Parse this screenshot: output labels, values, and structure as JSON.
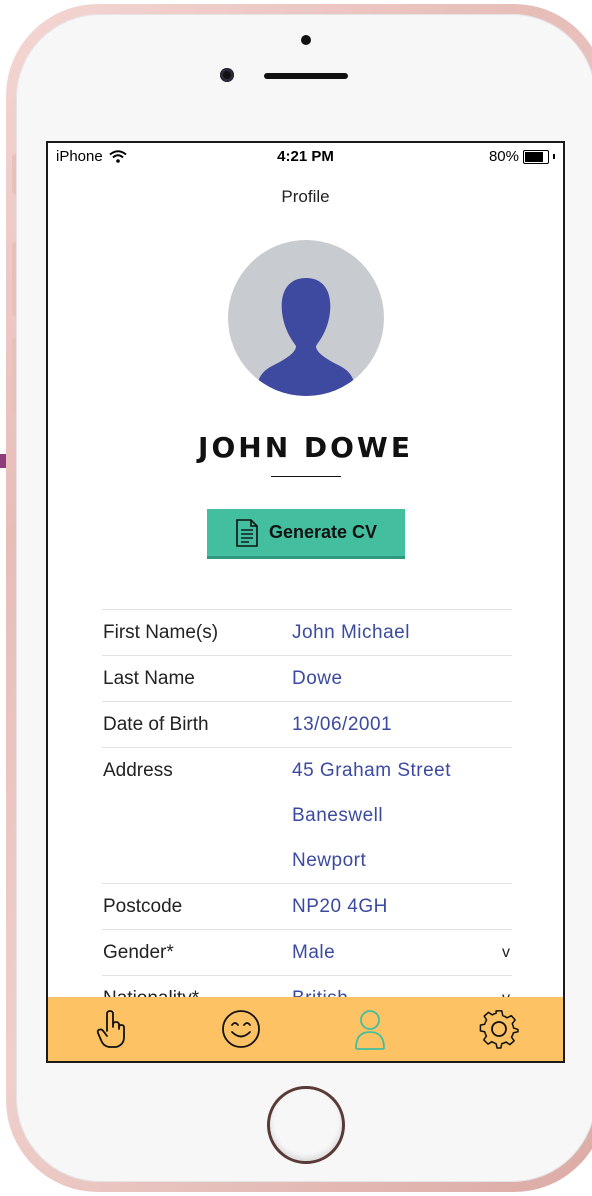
{
  "status_bar": {
    "carrier": "iPhone",
    "time": "4:21 PM",
    "battery": "80%",
    "battery_level": 0.8
  },
  "header": {
    "title": "Profile"
  },
  "profile": {
    "name": "JOHN DOWE",
    "avatar_icon": "person-silhouette-icon"
  },
  "actions": {
    "generate_cv_label": "Generate CV",
    "generate_cv_icon": "document-icon"
  },
  "details": {
    "first_name_label": "First Name(s)",
    "first_name_value": "John Michael",
    "last_name_label": "Last Name",
    "last_name_value": "Dowe",
    "dob_label": "Date of Birth",
    "dob_value": "13/06/2001",
    "address_label": "Address",
    "address_line1": "45 Graham Street",
    "address_line2": "Baneswell",
    "address_line3": "Newport",
    "postcode_label": "Postcode",
    "postcode_value": "NP20 4GH",
    "gender_label": "Gender*",
    "gender_value": "Male",
    "nationality_label": "Nationality*",
    "nationality_value": "British",
    "dropdown_chevron": "v"
  },
  "tab_bar": {
    "tabs": [
      {
        "icon": "pointing-hand-icon"
      },
      {
        "icon": "smiley-face-icon"
      },
      {
        "icon": "profile-person-icon"
      },
      {
        "icon": "gear-icon"
      }
    ],
    "active_tab": 2,
    "background_color": "#fcc264",
    "active_color": "#43bfa0"
  },
  "colors": {
    "accent_button": "#43bfa0",
    "value_text": "#3b4aa0",
    "avatar_figure": "#3e4aa0"
  }
}
